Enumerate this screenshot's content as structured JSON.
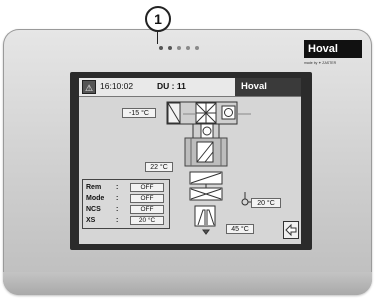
{
  "callout": {
    "number": "1"
  },
  "device": {
    "brand": "Hoval",
    "made_by": "made by ✦ ZASTER",
    "leds": 5
  },
  "screen": {
    "header": {
      "alarm_icon": "warning-triangle-icon",
      "time": "16:10:02",
      "du_label": "DU : 11",
      "logo": "Hoval"
    },
    "values": {
      "outdoor_temp": "-15 °C",
      "supply_temp": "22 °C",
      "room_temp": "20 °C",
      "water_temp": "45 °C"
    },
    "status": [
      {
        "label": "Rem",
        "sep": ":",
        "value": "OFF"
      },
      {
        "label": "Mode",
        "sep": ":",
        "value": "OFF"
      },
      {
        "label": "NCS",
        "sep": ":",
        "value": "OFF"
      },
      {
        "label": "XS",
        "sep": ":",
        "value": "20 °C"
      }
    ],
    "back_icon": "back-arrow-icon"
  },
  "colors": {
    "screen_bg": "#d6d6d6",
    "logo_bg": "#3a3a3a",
    "brand_bg": "#111111"
  }
}
